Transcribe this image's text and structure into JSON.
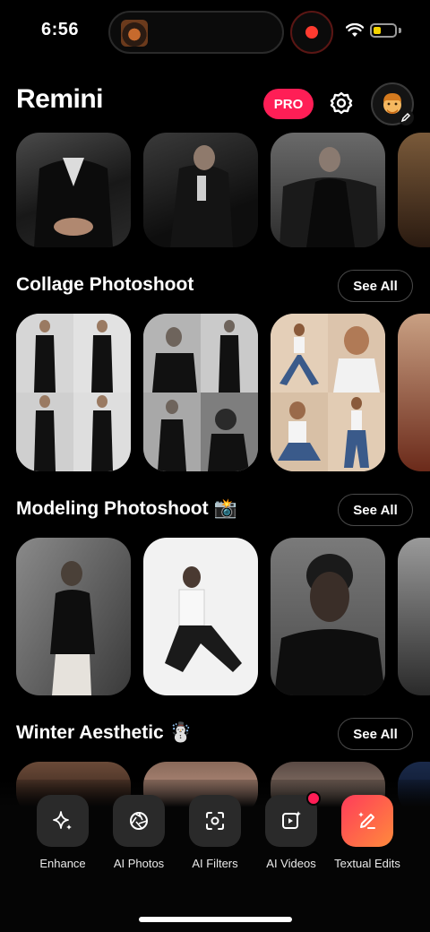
{
  "status_bar": {
    "time": "6:56",
    "battery_level": 0.35
  },
  "header": {
    "app_title": "Remini",
    "pro_label": "PRO"
  },
  "sections": [
    {
      "title": "Collage Photoshoot",
      "see_all": "See All"
    },
    {
      "title": "Modeling Photoshoot 📸",
      "see_all": "See All"
    },
    {
      "title": "Winter Aesthetic ☃️",
      "see_all": "See All"
    }
  ],
  "bottom_nav": [
    {
      "label": "Enhance",
      "icon": "sparkle-icon",
      "has_badge": false
    },
    {
      "label": "AI Photos",
      "icon": "aperture-icon",
      "has_badge": false
    },
    {
      "label": "AI Filters",
      "icon": "face-scan-icon",
      "has_badge": false
    },
    {
      "label": "AI Videos",
      "icon": "video-sparkle-icon",
      "has_badge": true
    },
    {
      "label": "Textual Edits",
      "icon": "magic-pen-icon",
      "has_badge": false
    }
  ],
  "colors": {
    "pro_badge": "#ff1e56",
    "notification_dot": "#ff1e56",
    "textual_edits_gradient": [
      "#ff3c5a",
      "#ff8a3c"
    ]
  }
}
